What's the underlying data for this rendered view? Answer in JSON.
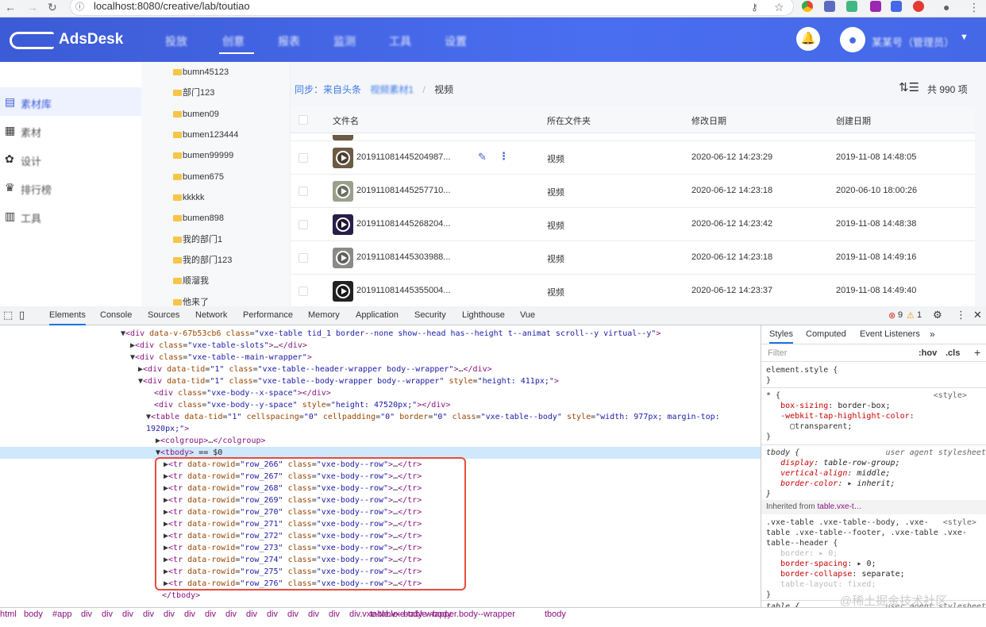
{
  "browser": {
    "url": "localhost:8080/creative/lab/toutiao"
  },
  "app": {
    "brand": "AdsDesk",
    "nav": [
      "投放",
      "创意",
      "报表",
      "监测",
      "工具",
      "设置"
    ],
    "user": "某某号（管理员）"
  },
  "sidebar": {
    "items": [
      {
        "icon": "library-icon",
        "label": "素材库"
      },
      {
        "icon": "folder-icon",
        "label": "素材"
      },
      {
        "icon": "palette-icon",
        "label": "设计"
      },
      {
        "icon": "trophy-icon",
        "label": "排行榜"
      },
      {
        "icon": "grid-icon",
        "label": "工具"
      }
    ]
  },
  "folders": [
    "bumn45123",
    "部门123",
    "bumen09",
    "bumen123444",
    "bumen99999",
    "bumen675",
    "kkkkk",
    "bumen898",
    "我的部门1",
    "我的部门123",
    "顺溜我",
    "他来了"
  ],
  "crumbs": {
    "sync": "同步：来自头条",
    "middle": "视频素材1",
    "sep": "/",
    "current": "视频"
  },
  "total": "共 990 项",
  "table": {
    "headers": [
      "文件名",
      "所在文件夹",
      "修改日期",
      "创建日期"
    ],
    "rows": [
      {
        "name": "201911081445204987...",
        "folder": "视频",
        "modified": "2020-06-12 14:23:29",
        "created": "2019-11-08 14:48:05",
        "color": "#6b5a44"
      },
      {
        "name": "201911081445257710...",
        "folder": "视频",
        "modified": "2020-06-12 14:23:18",
        "created": "2020-06-10 18:00:26",
        "color": "#9aa08c"
      },
      {
        "name": "201911081445268204...",
        "folder": "视频",
        "modified": "2020-06-12 14:23:42",
        "created": "2019-11-08 14:48:38",
        "color": "#2a1e48"
      },
      {
        "name": "201911081445303988...",
        "folder": "视频",
        "modified": "2020-06-12 14:23:18",
        "created": "2019-11-08 14:49:16",
        "color": "#8a8a86"
      },
      {
        "name": "201911081445355004...",
        "folder": "视频",
        "modified": "2020-06-12 14:23:37",
        "created": "2019-11-08 14:49:40",
        "color": "#222"
      }
    ]
  },
  "devtools": {
    "tabs": [
      "Elements",
      "Console",
      "Sources",
      "Network",
      "Performance",
      "Memory",
      "Application",
      "Security",
      "Lighthouse",
      "Vue"
    ],
    "errors": "9",
    "warnings": "1",
    "style_tabs": [
      "Styles",
      "Computed",
      "Event Listeners",
      "»"
    ],
    "filter": "Filter",
    "hov": ":hov",
    ".cls": ".cls",
    "breadcrumbs": [
      "html",
      "body",
      "#app",
      "div",
      "div",
      "div",
      "div",
      "div",
      "div",
      "div",
      "div",
      "div",
      "div",
      "div",
      "div",
      "div",
      "div.vxe-table--body-wrapper.body--wrapper",
      "table.vxe-table--body",
      "tbody"
    ],
    "watermark": "@稀土掘金技术社区"
  }
}
